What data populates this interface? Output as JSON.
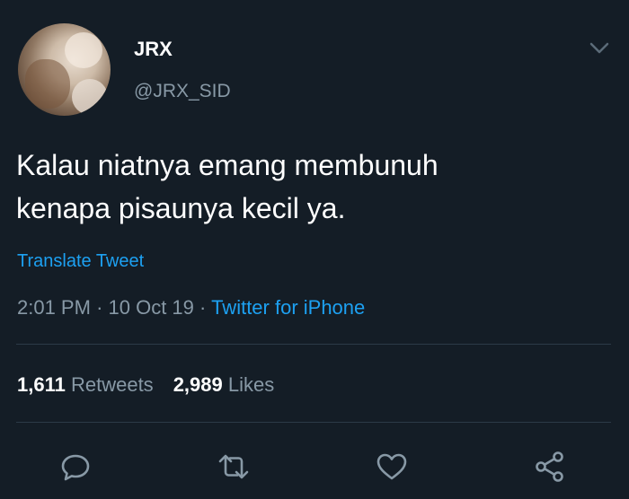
{
  "user": {
    "name": "JRX",
    "handle": "@JRX_SID"
  },
  "tweet": {
    "text_line1": "Kalau niatnya emang membunuh",
    "text_line2": "kenapa pisaunya kecil ya.",
    "translate_label": "Translate Tweet",
    "time": "2:01 PM",
    "separator": "·",
    "date": "10 Oct 19",
    "source": "Twitter for iPhone"
  },
  "stats": {
    "retweets_count": "1,611",
    "retweets_label": "Retweets",
    "likes_count": "2,989",
    "likes_label": "Likes"
  },
  "icons": {
    "menu": "chevron-down-icon",
    "reply": "reply-icon",
    "retweet": "retweet-icon",
    "like": "heart-icon",
    "share": "share-icon"
  },
  "colors": {
    "background": "#141d26",
    "primary_text": "#ffffff",
    "secondary_text": "#8899a6",
    "accent": "#1da1f2",
    "divider": "#2c3a47"
  }
}
